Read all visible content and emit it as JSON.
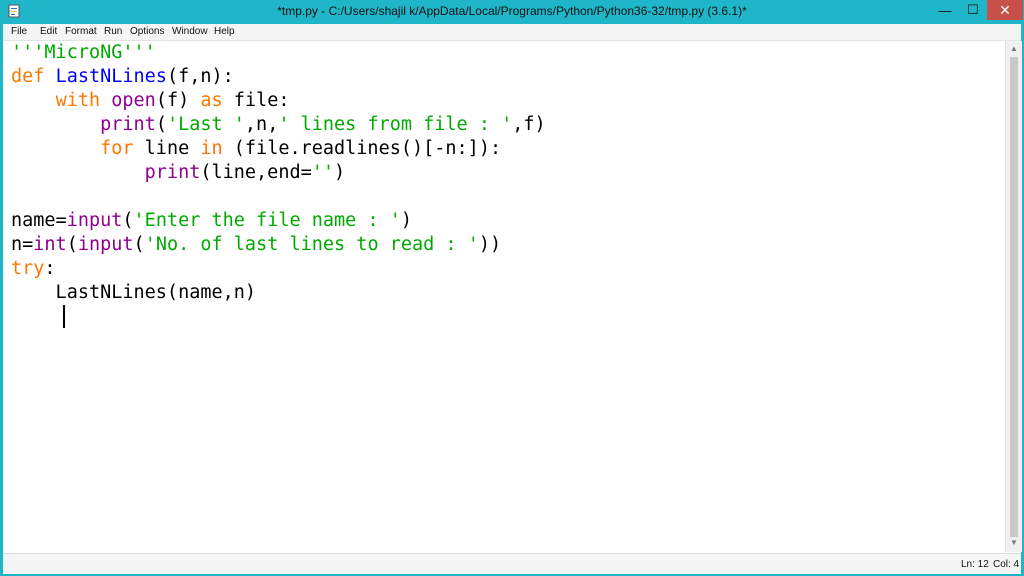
{
  "window": {
    "title": "*tmp.py - C:/Users/shajil k/AppData/Local/Programs/Python/Python36-32/tmp.py (3.6.1)*",
    "minimize_glyph": "—",
    "maximize_glyph": "☐",
    "close_glyph": "✕"
  },
  "menu": [
    "File",
    "Edit",
    "Format",
    "Run",
    "Options",
    "Window",
    "Help"
  ],
  "code": [
    [
      {
        "t": "'''MicroNG'''",
        "c": "str"
      }
    ],
    [
      {
        "t": "def",
        "c": "kw"
      },
      {
        "t": " "
      },
      {
        "t": "LastNLines",
        "c": "def"
      },
      {
        "t": "(f,n):"
      }
    ],
    [
      {
        "t": "    "
      },
      {
        "t": "with",
        "c": "kw"
      },
      {
        "t": " "
      },
      {
        "t": "open",
        "c": "bi"
      },
      {
        "t": "(f) "
      },
      {
        "t": "as",
        "c": "kw"
      },
      {
        "t": " file:"
      }
    ],
    [
      {
        "t": "        "
      },
      {
        "t": "print",
        "c": "bi"
      },
      {
        "t": "("
      },
      {
        "t": "'Last '",
        "c": "str"
      },
      {
        "t": ",n,"
      },
      {
        "t": "' lines from file : '",
        "c": "str"
      },
      {
        "t": ",f)"
      }
    ],
    [
      {
        "t": "        "
      },
      {
        "t": "for",
        "c": "kw"
      },
      {
        "t": " line "
      },
      {
        "t": "in",
        "c": "kw"
      },
      {
        "t": " (file.readlines()[-n:]):"
      }
    ],
    [
      {
        "t": "            "
      },
      {
        "t": "print",
        "c": "bi"
      },
      {
        "t": "(line,end="
      },
      {
        "t": "''",
        "c": "str"
      },
      {
        "t": ")"
      }
    ],
    [],
    [
      {
        "t": "name="
      },
      {
        "t": "input",
        "c": "bi"
      },
      {
        "t": "("
      },
      {
        "t": "'Enter the file name : '",
        "c": "str"
      },
      {
        "t": ")"
      }
    ],
    [
      {
        "t": "n="
      },
      {
        "t": "int",
        "c": "bi"
      },
      {
        "t": "("
      },
      {
        "t": "input",
        "c": "bi"
      },
      {
        "t": "("
      },
      {
        "t": "'No. of last lines to read : '",
        "c": "str"
      },
      {
        "t": "))"
      }
    ],
    [
      {
        "t": "try",
        "c": "kw"
      },
      {
        "t": ":"
      }
    ],
    [
      {
        "t": "    LastNLines(name,n)"
      }
    ],
    [
      {
        "t": "    "
      }
    ]
  ],
  "status": {
    "line": "Ln: 12",
    "col": "Col: 4"
  },
  "colors": {
    "keyword": "#ff7700",
    "builtin": "#900090",
    "string": "#00aa00",
    "definition": "#0000ff",
    "titlebar": "#1fb6c9"
  }
}
